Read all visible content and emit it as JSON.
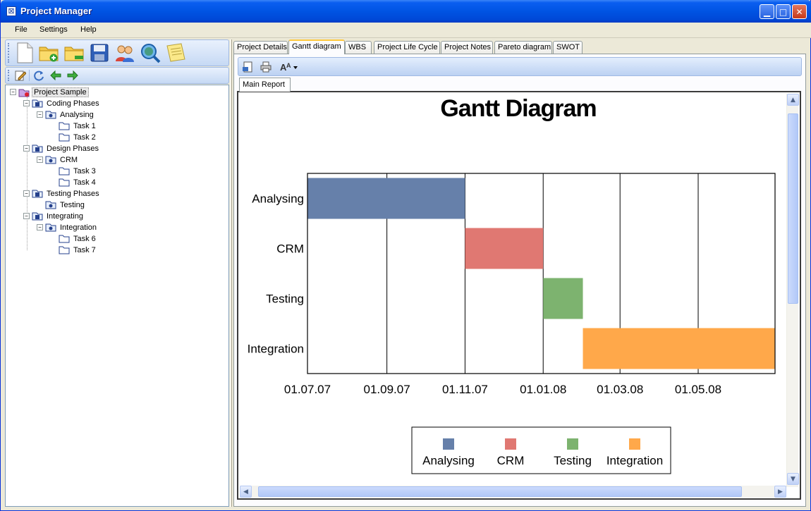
{
  "window": {
    "title": "Project Manager"
  },
  "menu": [
    "File",
    "Settings",
    "Help"
  ],
  "toolbar_icons": [
    "new-document-icon",
    "add-folder-icon",
    "remove-folder-icon",
    "save-icon",
    "users-icon",
    "search-icon",
    "notes-icon"
  ],
  "tree_toolbar_icons": [
    "edit-icon",
    "refresh-icon",
    "back-arrow-icon",
    "forward-arrow-icon"
  ],
  "tree": {
    "root": "Project Sample",
    "phases": [
      {
        "label": "Coding Phases",
        "groups": [
          {
            "label": "Analysing",
            "tasks": [
              "Task 1",
              "Task 2"
            ]
          }
        ]
      },
      {
        "label": "Design Phases",
        "groups": [
          {
            "label": "CRM",
            "tasks": [
              "Task 3",
              "Task 4"
            ]
          }
        ]
      },
      {
        "label": "Testing Phases",
        "groups": [
          {
            "label": "Testing",
            "tasks": []
          }
        ]
      },
      {
        "label": "Integrating",
        "groups": [
          {
            "label": "Integration",
            "tasks": [
              "Task 6",
              "Task 7"
            ]
          }
        ]
      }
    ]
  },
  "tabs": [
    "Project Details",
    "Gantt diagram",
    "WBS",
    "Project Life Cycle",
    "Project Notes",
    "Pareto diagram",
    "SWOT"
  ],
  "active_tab": "Gantt diagram",
  "report": {
    "subtab": "Main Report",
    "toolbar_icons": [
      "export-icon",
      "print-icon",
      "zoom-icon"
    ]
  },
  "chart_data": {
    "type": "bar",
    "orientation": "horizontal-gantt",
    "title": "Gantt Diagram",
    "categories": [
      "Analysing",
      "CRM",
      "Testing",
      "Integration"
    ],
    "x_ticks": [
      "01.07.07",
      "01.09.07",
      "01.11.07",
      "01.01.08",
      "01.03.08",
      "01.05.08"
    ],
    "xlim": [
      "2007-07-01",
      "2008-06-30"
    ],
    "grid": true,
    "legend_position": "bottom-center",
    "series": [
      {
        "name": "Analysing",
        "start": "2007-07-01",
        "end": "2007-11-01",
        "color": "#6680aa"
      },
      {
        "name": "CRM",
        "start": "2007-11-01",
        "end": "2008-01-01",
        "color": "#e07872"
      },
      {
        "name": "Testing",
        "start": "2008-01-01",
        "end": "2008-02-01",
        "color": "#7db36f"
      },
      {
        "name": "Integration",
        "start": "2008-02-01",
        "end": "2008-06-30",
        "color": "#ffa84a"
      }
    ]
  }
}
